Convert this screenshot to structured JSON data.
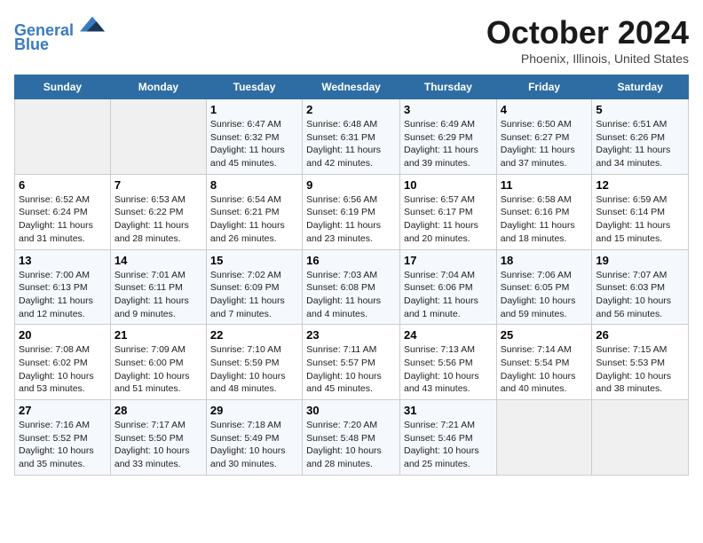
{
  "header": {
    "logo_line1": "General",
    "logo_line2": "Blue",
    "month": "October 2024",
    "location": "Phoenix, Illinois, United States"
  },
  "weekdays": [
    "Sunday",
    "Monday",
    "Tuesday",
    "Wednesday",
    "Thursday",
    "Friday",
    "Saturday"
  ],
  "weeks": [
    [
      {
        "day": "",
        "info": ""
      },
      {
        "day": "",
        "info": ""
      },
      {
        "day": "1",
        "info": "Sunrise: 6:47 AM\nSunset: 6:32 PM\nDaylight: 11 hours and 45 minutes."
      },
      {
        "day": "2",
        "info": "Sunrise: 6:48 AM\nSunset: 6:31 PM\nDaylight: 11 hours and 42 minutes."
      },
      {
        "day": "3",
        "info": "Sunrise: 6:49 AM\nSunset: 6:29 PM\nDaylight: 11 hours and 39 minutes."
      },
      {
        "day": "4",
        "info": "Sunrise: 6:50 AM\nSunset: 6:27 PM\nDaylight: 11 hours and 37 minutes."
      },
      {
        "day": "5",
        "info": "Sunrise: 6:51 AM\nSunset: 6:26 PM\nDaylight: 11 hours and 34 minutes."
      }
    ],
    [
      {
        "day": "6",
        "info": "Sunrise: 6:52 AM\nSunset: 6:24 PM\nDaylight: 11 hours and 31 minutes."
      },
      {
        "day": "7",
        "info": "Sunrise: 6:53 AM\nSunset: 6:22 PM\nDaylight: 11 hours and 28 minutes."
      },
      {
        "day": "8",
        "info": "Sunrise: 6:54 AM\nSunset: 6:21 PM\nDaylight: 11 hours and 26 minutes."
      },
      {
        "day": "9",
        "info": "Sunrise: 6:56 AM\nSunset: 6:19 PM\nDaylight: 11 hours and 23 minutes."
      },
      {
        "day": "10",
        "info": "Sunrise: 6:57 AM\nSunset: 6:17 PM\nDaylight: 11 hours and 20 minutes."
      },
      {
        "day": "11",
        "info": "Sunrise: 6:58 AM\nSunset: 6:16 PM\nDaylight: 11 hours and 18 minutes."
      },
      {
        "day": "12",
        "info": "Sunrise: 6:59 AM\nSunset: 6:14 PM\nDaylight: 11 hours and 15 minutes."
      }
    ],
    [
      {
        "day": "13",
        "info": "Sunrise: 7:00 AM\nSunset: 6:13 PM\nDaylight: 11 hours and 12 minutes."
      },
      {
        "day": "14",
        "info": "Sunrise: 7:01 AM\nSunset: 6:11 PM\nDaylight: 11 hours and 9 minutes."
      },
      {
        "day": "15",
        "info": "Sunrise: 7:02 AM\nSunset: 6:09 PM\nDaylight: 11 hours and 7 minutes."
      },
      {
        "day": "16",
        "info": "Sunrise: 7:03 AM\nSunset: 6:08 PM\nDaylight: 11 hours and 4 minutes."
      },
      {
        "day": "17",
        "info": "Sunrise: 7:04 AM\nSunset: 6:06 PM\nDaylight: 11 hours and 1 minute."
      },
      {
        "day": "18",
        "info": "Sunrise: 7:06 AM\nSunset: 6:05 PM\nDaylight: 10 hours and 59 minutes."
      },
      {
        "day": "19",
        "info": "Sunrise: 7:07 AM\nSunset: 6:03 PM\nDaylight: 10 hours and 56 minutes."
      }
    ],
    [
      {
        "day": "20",
        "info": "Sunrise: 7:08 AM\nSunset: 6:02 PM\nDaylight: 10 hours and 53 minutes."
      },
      {
        "day": "21",
        "info": "Sunrise: 7:09 AM\nSunset: 6:00 PM\nDaylight: 10 hours and 51 minutes."
      },
      {
        "day": "22",
        "info": "Sunrise: 7:10 AM\nSunset: 5:59 PM\nDaylight: 10 hours and 48 minutes."
      },
      {
        "day": "23",
        "info": "Sunrise: 7:11 AM\nSunset: 5:57 PM\nDaylight: 10 hours and 45 minutes."
      },
      {
        "day": "24",
        "info": "Sunrise: 7:13 AM\nSunset: 5:56 PM\nDaylight: 10 hours and 43 minutes."
      },
      {
        "day": "25",
        "info": "Sunrise: 7:14 AM\nSunset: 5:54 PM\nDaylight: 10 hours and 40 minutes."
      },
      {
        "day": "26",
        "info": "Sunrise: 7:15 AM\nSunset: 5:53 PM\nDaylight: 10 hours and 38 minutes."
      }
    ],
    [
      {
        "day": "27",
        "info": "Sunrise: 7:16 AM\nSunset: 5:52 PM\nDaylight: 10 hours and 35 minutes."
      },
      {
        "day": "28",
        "info": "Sunrise: 7:17 AM\nSunset: 5:50 PM\nDaylight: 10 hours and 33 minutes."
      },
      {
        "day": "29",
        "info": "Sunrise: 7:18 AM\nSunset: 5:49 PM\nDaylight: 10 hours and 30 minutes."
      },
      {
        "day": "30",
        "info": "Sunrise: 7:20 AM\nSunset: 5:48 PM\nDaylight: 10 hours and 28 minutes."
      },
      {
        "day": "31",
        "info": "Sunrise: 7:21 AM\nSunset: 5:46 PM\nDaylight: 10 hours and 25 minutes."
      },
      {
        "day": "",
        "info": ""
      },
      {
        "day": "",
        "info": ""
      }
    ]
  ]
}
